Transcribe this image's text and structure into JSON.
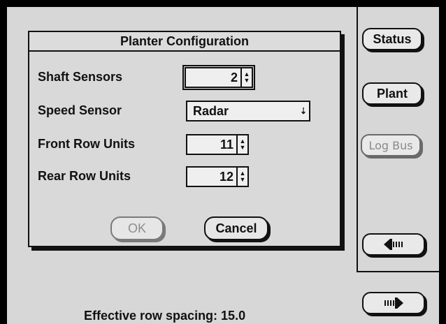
{
  "dialog": {
    "title": "Planter Configuration",
    "rows": [
      {
        "label": "Shaft Sensors",
        "value": "2"
      },
      {
        "label": "Speed Sensor",
        "value": "Radar"
      },
      {
        "label": "Front Row Units",
        "value": "11"
      },
      {
        "label": "Rear Row Units",
        "value": "12"
      }
    ],
    "ok_label": "OK",
    "cancel_label": "Cancel"
  },
  "side": {
    "status_label": "Status",
    "plant_label": "Plant",
    "logbus_label": "Log Bus",
    "back_icon": "arrow-left-icon",
    "next_icon": "arrow-right-icon"
  },
  "status": {
    "text": "Effective row spacing: 15.0"
  }
}
